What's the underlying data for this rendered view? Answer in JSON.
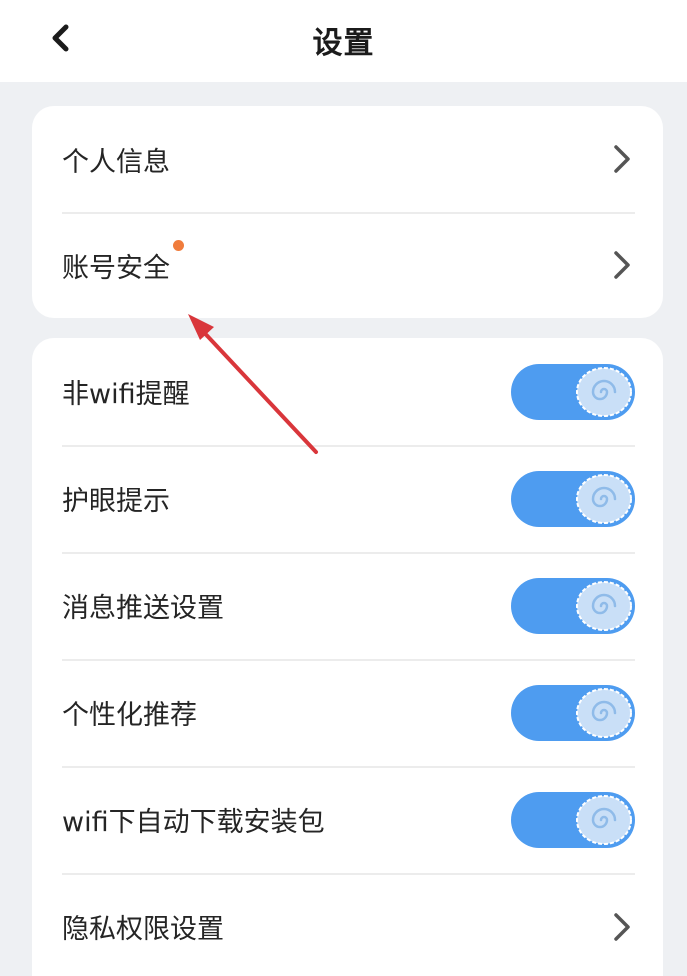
{
  "header": {
    "title": "设置",
    "back_icon": "chevron-left-icon"
  },
  "group_account": {
    "items": [
      {
        "label": "个人信息",
        "has_dot": false
      },
      {
        "label": "账号安全",
        "has_dot": true
      }
    ]
  },
  "group_prefs": {
    "items": [
      {
        "label": "非wifi提醒",
        "type": "toggle",
        "on": true
      },
      {
        "label": "护眼提示",
        "type": "toggle",
        "on": true
      },
      {
        "label": "消息推送设置",
        "type": "toggle",
        "on": true
      },
      {
        "label": "个性化推荐",
        "type": "toggle",
        "on": true
      },
      {
        "label": "wifi下自动下载安装包",
        "type": "toggle",
        "on": true
      },
      {
        "label": "隐私权限设置",
        "type": "link"
      }
    ]
  },
  "colors": {
    "toggle_on": "#4e9cf0",
    "knob": "#c9dff7",
    "notification_dot": "#f07c3c",
    "annotation_arrow": "#d9363b"
  }
}
